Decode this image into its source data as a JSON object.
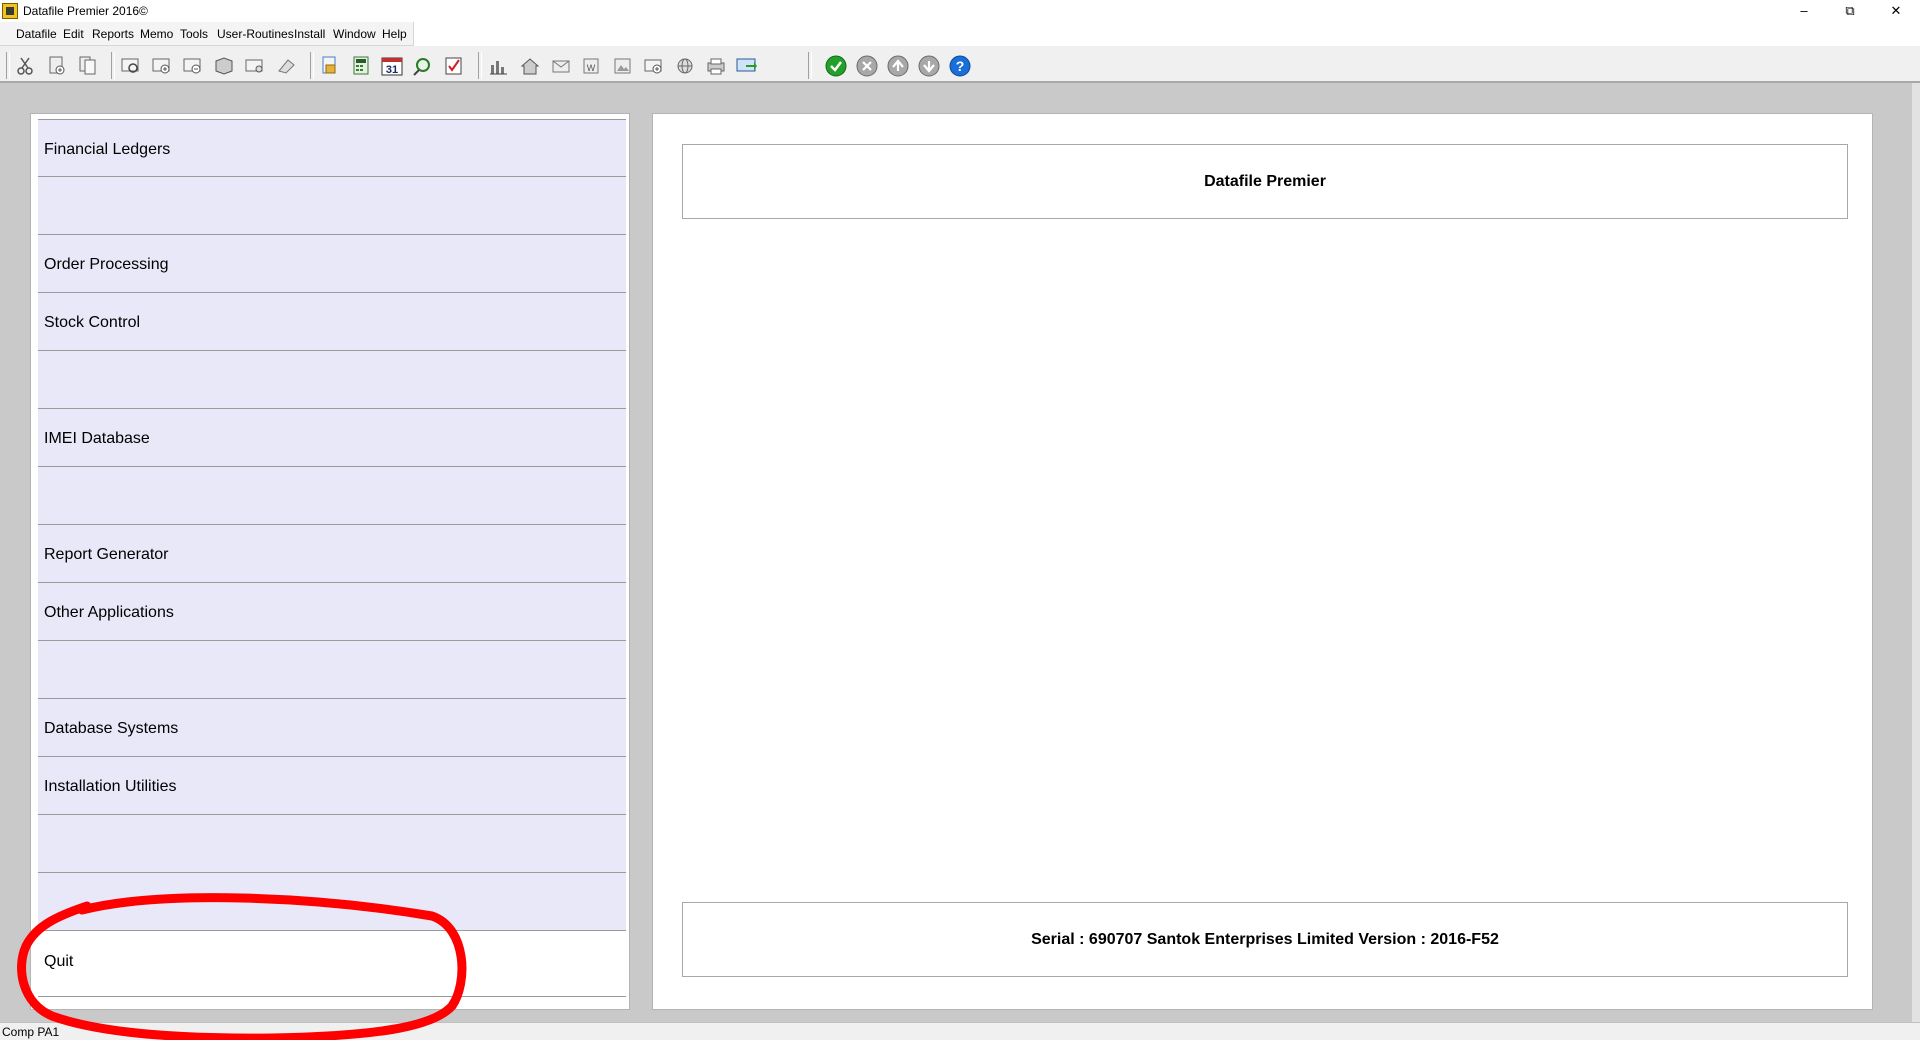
{
  "window": {
    "title": "Datafile  Premier 2016©",
    "controls": [
      "–",
      "⧉",
      "✕"
    ]
  },
  "menubar": [
    "Datafile",
    "Edit",
    "Reports",
    "Memo",
    "Tools",
    "User-Routines",
    "Install",
    "Window",
    "Help"
  ],
  "toolbar": {
    "groups": [
      [
        "cut-icon",
        "new-document-icon",
        "copy-document-icon"
      ],
      [
        "preview-icon",
        "add-record-icon",
        "delete-record-icon",
        "archive-icon",
        "print-setup-icon",
        "eraser-icon"
      ],
      [
        "file-icon",
        "calculator-icon",
        "calendar-icon",
        "search-chart-icon",
        "checklist-icon"
      ],
      [
        "bar-chart-icon",
        "home-icon",
        "mail-icon",
        "word-icon",
        "image-icon",
        "add-window-icon",
        "globe-icon",
        "printer-icon",
        "export-icon"
      ],
      [
        "ok-icon",
        "cancel-icon",
        "up-icon",
        "down-icon",
        "help-icon"
      ]
    ],
    "calendar_text": "31",
    "help_text": "?",
    "accent_ok": "#22a02a",
    "accent_help": "#1a6fd6"
  },
  "left_menu": {
    "rows": [
      "Financial Ledgers",
      "",
      "Order Processing",
      "Stock Control",
      "",
      "IMEI Database",
      "",
      "Report Generator",
      "Other Applications",
      "",
      "Database Systems",
      "Installation Utilities",
      "",
      ""
    ],
    "quit_label": "Quit",
    "row_color": "#e8e8f8"
  },
  "right_panel": {
    "title": "Datafile Premier",
    "footer": "Serial : 690707   Santok Enterprises Limited   Version :  2016-F52"
  },
  "status": {
    "text": "Comp PA1"
  },
  "annotation_color": "#ff0000"
}
